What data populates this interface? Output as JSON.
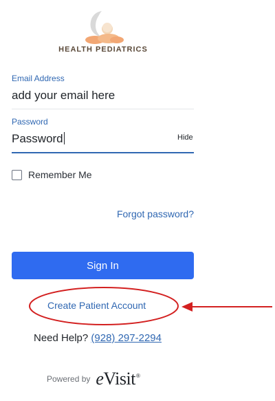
{
  "brand": {
    "logo_text": "HEALTH PEDIATRICS",
    "icon": "moon-baby-cloud-icon",
    "colors": {
      "moon": "#d9d9d9",
      "cloud": "#f2a774",
      "text": "#5b4a3a"
    }
  },
  "form": {
    "email_label": "Email Address",
    "email_value": "add your email here",
    "password_label": "Password",
    "password_value": "Password",
    "hide_label": "Hide",
    "remember_label": "Remember Me",
    "remember_checked": false,
    "forgot_label": "Forgot password?",
    "signin_label": "Sign In",
    "create_account_label": "Create Patient Account"
  },
  "help": {
    "prefix": "Need Help?",
    "phone": "(928) 297-2294"
  },
  "footer": {
    "powered_by": "Powered by",
    "logo_word": "Visit"
  },
  "annotation": {
    "color": "#d32020",
    "shape": "ellipse-with-arrow"
  },
  "colors": {
    "primary_button": "#2f6bf0",
    "link": "#2f67b2",
    "active_underline": "#2f67b2"
  }
}
